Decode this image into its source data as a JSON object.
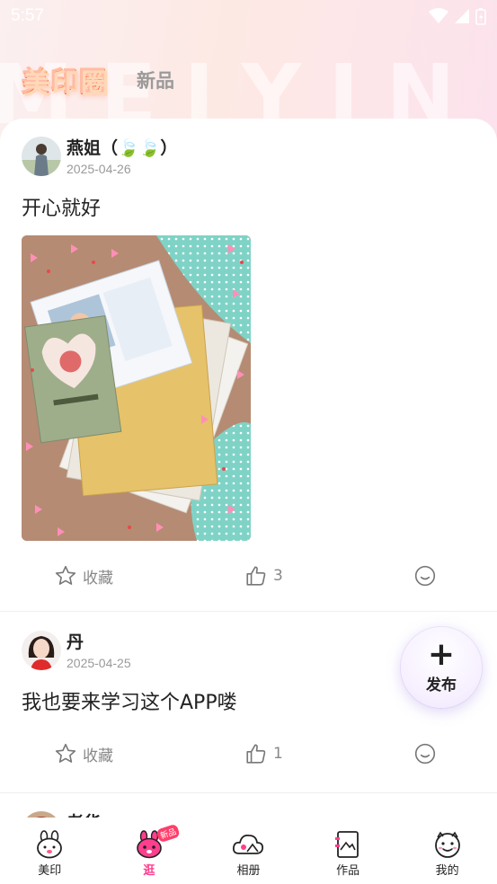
{
  "status_bar": {
    "time": "5:57"
  },
  "header": {
    "logo_text": "美印圈",
    "tab_new": "新品",
    "watermark": "MEIYIN"
  },
  "posts": [
    {
      "user": "燕姐（🍃🍃）",
      "date": "2025-04-26",
      "text": "开心就好",
      "fav_label": "收藏",
      "likes": "3"
    },
    {
      "user": "丹",
      "date": "2025-04-25",
      "text": "我也要来学习这个APP喽",
      "fav_label": "收藏",
      "likes": "1"
    },
    {
      "user": "老华"
    }
  ],
  "fab": {
    "plus": "+",
    "label": "发布"
  },
  "nav": {
    "items": [
      {
        "label": "美印",
        "icon": "bunny-face-icon"
      },
      {
        "label": "逛",
        "icon": "bunny-pink-icon",
        "badge": "新品"
      },
      {
        "label": "相册",
        "icon": "cloud-photo-icon"
      },
      {
        "label": "作品",
        "icon": "image-frame-icon"
      },
      {
        "label": "我的",
        "icon": "smile-face-icon"
      }
    ]
  },
  "colors": {
    "accent": "#ff3e8e",
    "text": "#222222",
    "muted": "#9a9a9a"
  }
}
